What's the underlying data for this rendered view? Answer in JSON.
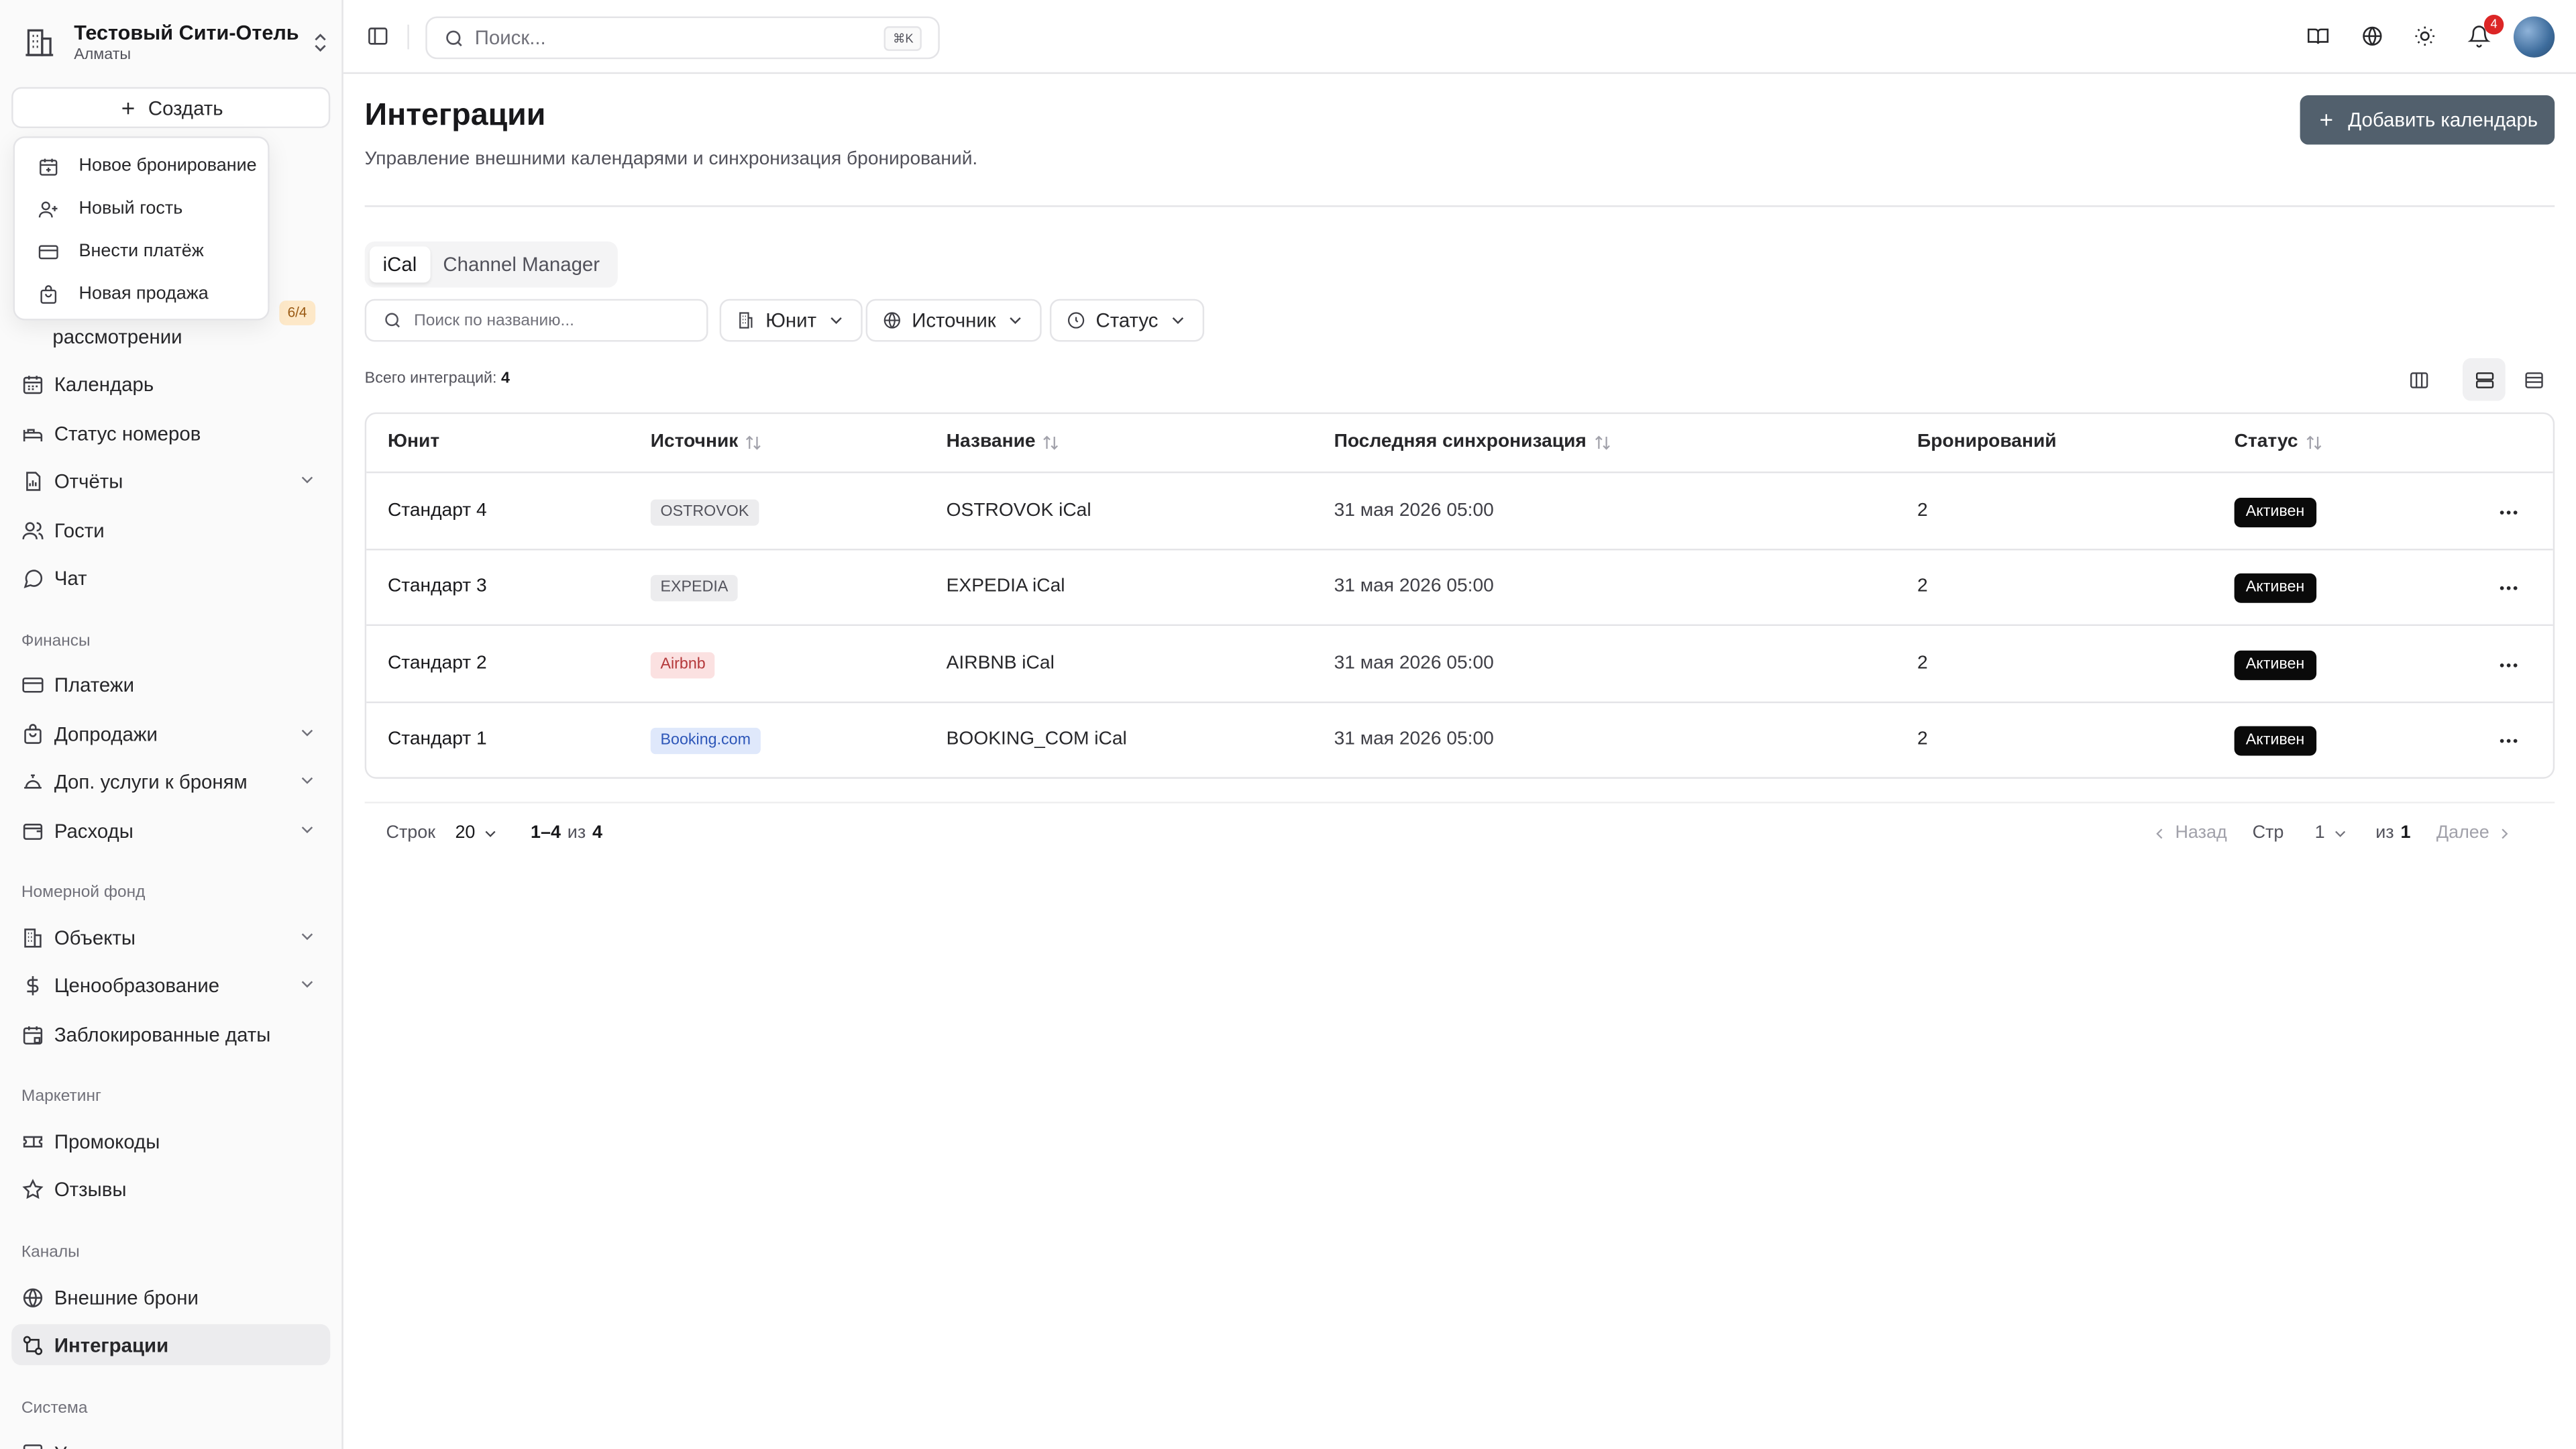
{
  "hotel": {
    "name": "Тестовый Сити-Отель",
    "city": "Алматы"
  },
  "create_label": "Создать",
  "create_menu": [
    {
      "label": "Новое бронирование",
      "icon": "calendar-plus-icon"
    },
    {
      "label": "Новый гость",
      "icon": "user-plus-icon"
    },
    {
      "label": "Внести платёж",
      "icon": "credit-card-icon"
    },
    {
      "label": "Новая продажа",
      "icon": "shopping-bag-icon"
    }
  ],
  "sidebar": {
    "pending_badge": "6/4",
    "pending_label_partial": "рассмотрении",
    "items_top": [
      {
        "label": "Календарь",
        "icon": "calendar-icon"
      },
      {
        "label": "Статус номеров",
        "icon": "bed-icon"
      },
      {
        "label": "Отчёты",
        "icon": "report-icon"
      },
      {
        "label": "Гости",
        "icon": "users-icon"
      },
      {
        "label": "Чат",
        "icon": "chat-icon"
      }
    ],
    "groups": {
      "finance": "Финансы",
      "rooms": "Номерной фонд",
      "marketing": "Маркетинг",
      "channels": "Каналы",
      "system": "Система"
    },
    "finance_items": [
      {
        "label": "Платежи",
        "icon": "card-icon"
      },
      {
        "label": "Допродажи",
        "icon": "bag-icon"
      },
      {
        "label": "Доп. услуги к броням",
        "icon": "service-bell-icon"
      },
      {
        "label": "Расходы",
        "icon": "wallet-icon"
      }
    ],
    "rooms_items": [
      {
        "label": "Объекты",
        "icon": "building-icon"
      },
      {
        "label": "Ценообразование",
        "icon": "dollar-icon"
      },
      {
        "label": "Заблокированные даты",
        "icon": "calendar-lock-icon"
      }
    ],
    "marketing_items": [
      {
        "label": "Промокоды",
        "icon": "ticket-icon"
      },
      {
        "label": "Отзывы",
        "icon": "star-icon"
      }
    ],
    "channels_items": [
      {
        "label": "Внешние брони",
        "icon": "globe-icon"
      },
      {
        "label": "Интеграции",
        "icon": "integration-icon"
      }
    ],
    "system_partial": "У"
  },
  "topbar": {
    "search_placeholder": "Поиск...",
    "search_kbd": "⌘K",
    "notifications": "4"
  },
  "page": {
    "title": "Интеграции",
    "subtitle": "Управление внешними календарями и синхронизация бронирований.",
    "add_button": "Добавить календарь"
  },
  "tabs": [
    "iCal",
    "Channel Manager"
  ],
  "filters": {
    "search_placeholder": "Поиск по названию...",
    "unit": "Юнит",
    "source": "Источник",
    "status": "Статус"
  },
  "total": {
    "label": "Всего интеграций:",
    "value": "4"
  },
  "columns": [
    "Юнит",
    "Источник",
    "Название",
    "Последняя синхронизация",
    "Бронирований",
    "Статус"
  ],
  "rows": [
    {
      "unit": "Стандарт 4",
      "source": "OSTROVOK",
      "source_bg": "#ececee",
      "source_fg": "#52525b",
      "name": "OSTROVOK iCal",
      "sync": "31 мая 2026 05:00",
      "bookings": "2",
      "status": "Активен"
    },
    {
      "unit": "Стандарт 3",
      "source": "EXPEDIA",
      "source_bg": "#ececee",
      "source_fg": "#52525b",
      "name": "EXPEDIA iCal",
      "sync": "31 мая 2026 05:00",
      "bookings": "2",
      "status": "Активен"
    },
    {
      "unit": "Стандарт 2",
      "source": "Airbnb",
      "source_bg": "#fbe1e1",
      "source_fg": "#b4383a",
      "name": "AIRBNB iCal",
      "sync": "31 мая 2026 05:00",
      "bookings": "2",
      "status": "Активен"
    },
    {
      "unit": "Стандарт 1",
      "source": "Booking.com",
      "source_bg": "#dfe8fb",
      "source_fg": "#2d56b8",
      "name": "BOOKING_COM iCal",
      "sync": "31 мая 2026 05:00",
      "bookings": "2",
      "status": "Активен"
    }
  ],
  "pager": {
    "rows_label": "Строк",
    "rows_value": "20",
    "range": "1–4",
    "of_word": "из",
    "total": "4",
    "back": "Назад",
    "page_label": "Стр",
    "page_value": "1",
    "of_pages": "из",
    "pages_total": "1",
    "next": "Далее"
  }
}
